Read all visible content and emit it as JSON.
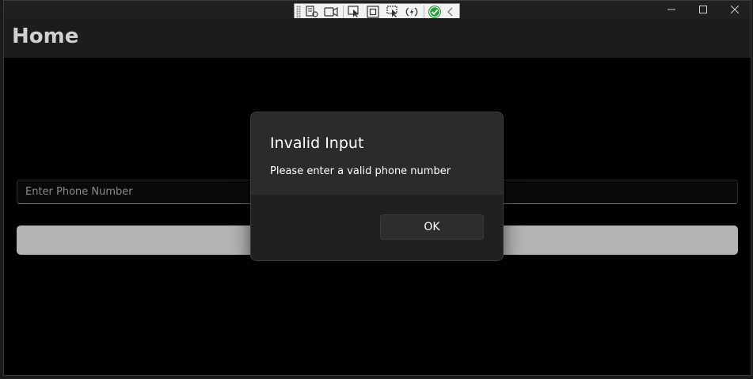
{
  "page": {
    "title": "Home",
    "phone_input": {
      "placeholder": "Enter Phone Number",
      "value": ""
    },
    "submit_button": {
      "label": ""
    }
  },
  "dialog": {
    "title": "Invalid Input",
    "message": "Please enter a valid phone number",
    "ok_label": "OK"
  },
  "debug_toolbar": {
    "icons": [
      "live-visual-tree-icon",
      "record-icon",
      "select-element-icon",
      "display-layout-adorners-icon",
      "track-focused-element-icon",
      "hot-reload-icon",
      "xaml-binding-ok-icon",
      "collapse-icon"
    ]
  },
  "window_controls": [
    "minimize-icon",
    "maximize-icon",
    "close-icon"
  ],
  "colors": {
    "page_background": "#000000",
    "header_background": "#1c1c1c",
    "dialog_background": "#2b2b2b",
    "button_gray": "#b3b3b3",
    "accent_green": "#2e9b3c"
  }
}
